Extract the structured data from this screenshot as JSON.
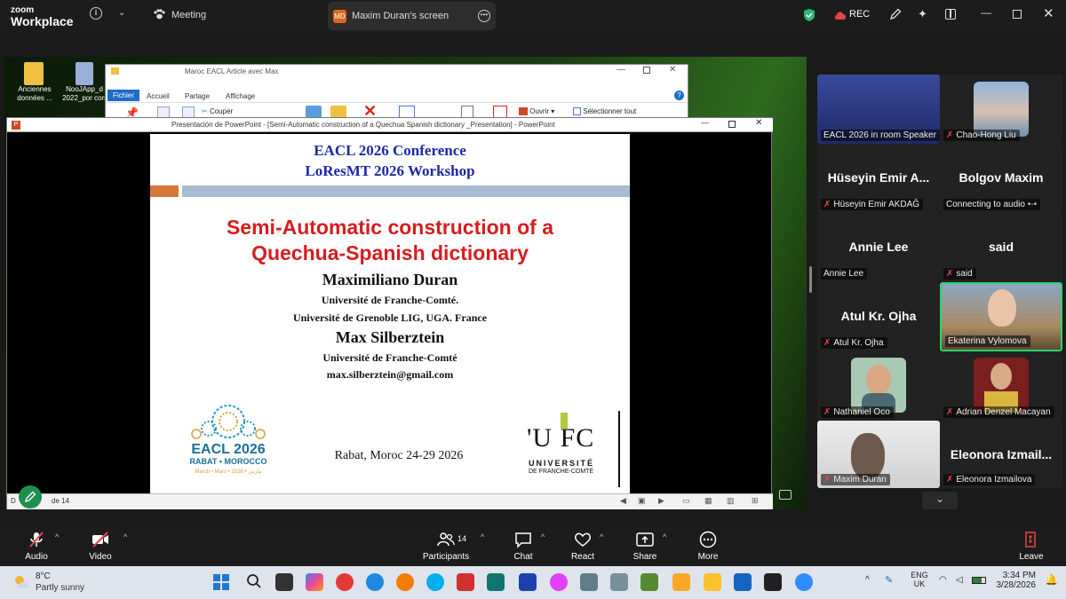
{
  "zoom": {
    "logo_line1": "zoom",
    "logo_line2": "Workplace",
    "meeting_label": "Meeting",
    "share_badge": "MD",
    "share_title": "Maxim Duran's screen",
    "rec_label": "REC"
  },
  "desktop": {
    "icons": [
      {
        "label": "Anciennes données ..."
      },
      {
        "label": "NooJApp_d 2022_por corr"
      }
    ]
  },
  "explorer": {
    "title": "Maroc EACL Article avec Max",
    "tabs": [
      "Fichier",
      "Accueil",
      "Partage",
      "Affichage"
    ],
    "commands": {
      "cut": "Couper",
      "open": "Ouvrir",
      "select_all": "Sélectionner tout"
    }
  },
  "powerpoint": {
    "title": "Presentación de PowerPoint - [Semi-Automatic construction of a Quechua Spanish dictionary _Presentation] - PowerPoint",
    "status_left": "D",
    "status_right": "de 14"
  },
  "slide": {
    "conf1": "EACL 2026 Conference",
    "conf2": "LoResMT 2026 Workshop",
    "title1": "Semi-Automatic  construction of a",
    "title2": "Quechua-Spanish dictionary",
    "author1": "Maximiliano Duran",
    "affil1a": "Université de Franche-Comté.",
    "affil1b": "Université de Grenoble LIG, UGA. France",
    "author2": "Max Silberztein",
    "affil2": "Université de Franche-Comté",
    "email": "max.silberztein@gmail.com",
    "location": "Rabat, Moroc 24-29 2026",
    "eacl_logo": {
      "line1": "EACL 2026",
      "line2": "RABAT • MOROCCO",
      "line3": "March • Mars • 2026 • مارس"
    },
    "ufc_logo": {
      "mark": "'U FC",
      "line1": "UNIVERSITÉ",
      "line2": "DE FRANCHE-COMTÉ"
    }
  },
  "participants": [
    {
      "label": "EACL 2026 in room Speaker",
      "muted": false
    },
    {
      "label": "Chao-Hong Liu",
      "muted": true
    },
    {
      "big": "Hüseyin  Emir  A...",
      "label": "Hüseyin Emir AKDAĞ",
      "muted": true
    },
    {
      "big": "Bolgov Maxim",
      "label": "Connecting to audio",
      "muted": false
    },
    {
      "big": "Annie Lee",
      "label": "Annie Lee",
      "muted": false
    },
    {
      "big": "said",
      "label": "said",
      "muted": true
    },
    {
      "big": "Atul Kr. Ojha",
      "label": "Atul Kr. Ojha",
      "muted": true
    },
    {
      "label": "Ekaterina Vylomova",
      "muted": false
    },
    {
      "label": "Nathaniel Oco",
      "muted": true
    },
    {
      "label": "Adrian Denzel Macayan",
      "muted": true
    },
    {
      "label": "Maxim Duran",
      "muted": true
    },
    {
      "big": "Eleonora  Izmail...",
      "label": "Eleonora Izmailova",
      "muted": true
    }
  ],
  "toolbar": {
    "audio": "Audio",
    "video": "Video",
    "participants": "Participants",
    "participants_count": "14",
    "chat": "Chat",
    "react": "React",
    "share": "Share",
    "more": "More",
    "leave": "Leave"
  },
  "taskbar": {
    "weather_temp": "8°C",
    "weather_desc": "Partly sunny",
    "lang1": "ENG",
    "lang2": "UK",
    "time": "3:34 PM",
    "date": "3/28/2026"
  },
  "colors": {
    "leave_red": "#e64545",
    "zoom_bg": "#1c1c1c",
    "slide_title_red": "#d61d1d",
    "slide_conf_blue": "#1a28a8"
  }
}
